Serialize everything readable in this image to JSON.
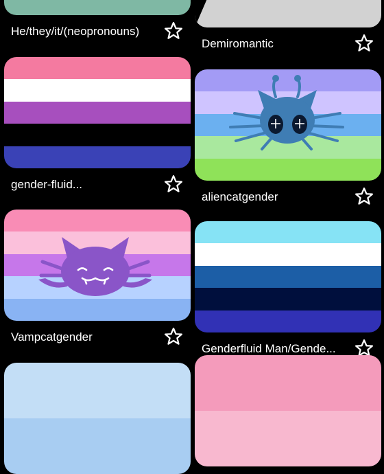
{
  "flags": [
    {
      "label": "He/they/it/(neopronouns)",
      "stripes": [
        "#7fb8a4"
      ],
      "overlay": "none",
      "favorite": false,
      "star_icon": "star-outline-icon"
    },
    {
      "label": "Demiromantic",
      "stripes": [
        "#d2d2d2"
      ],
      "overlay": "demi-chevron",
      "favorite": false,
      "star_icon": "star-outline-icon"
    },
    {
      "label": "gender-fluid...",
      "stripes": [
        "#f47aa0",
        "#ffffff",
        "#a74fbe",
        "#000000",
        "#3a42b6"
      ],
      "overlay": "none",
      "favorite": false,
      "star_icon": "star-outline-icon"
    },
    {
      "label": "aliencatgender",
      "stripes": [
        "#a39bf5",
        "#cfc4ff",
        "#6bb0f0",
        "#a9e89e",
        "#8fe259"
      ],
      "overlay": "alien-cat-icon",
      "favorite": false,
      "star_icon": "star-outline-icon"
    },
    {
      "label": "Vampcatgender",
      "stripes": [
        "#f98cb5",
        "#fbc0db",
        "#c677ea",
        "#b7d2ff",
        "#89b3f3"
      ],
      "overlay": "vamp-cat-icon",
      "favorite": false,
      "star_icon": "star-outline-icon"
    },
    {
      "label": "Genderfluid Man/Gende...",
      "stripes": [
        "#86e3f5",
        "#ffffff",
        "#1c5ea6",
        "#000f3d",
        "#3131b5"
      ],
      "overlay": "none",
      "favorite": false,
      "star_icon": "star-outline-icon"
    },
    {
      "label": "",
      "stripes": [
        "#c3def6",
        "#a8cdf2"
      ],
      "overlay": "none",
      "favorite": false,
      "star_icon": "star-outline-icon"
    },
    {
      "label": "",
      "stripes": [
        "#f49bbb",
        "#f8b8cf"
      ],
      "overlay": "none",
      "favorite": false,
      "star_icon": "star-outline-icon"
    }
  ]
}
